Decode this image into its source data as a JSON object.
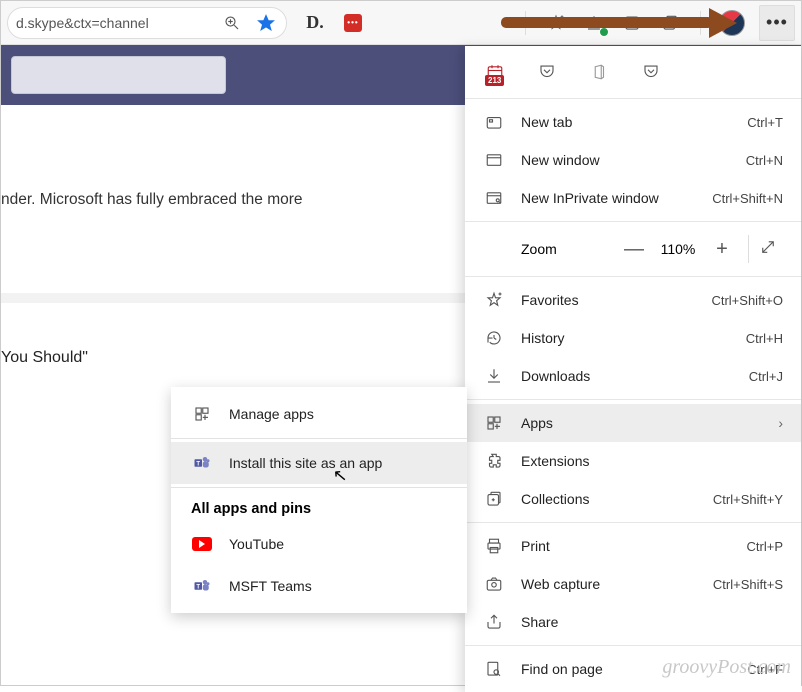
{
  "address_bar": {
    "url_text": "d.skype&ctx=channel"
  },
  "toolbar_icon_row": {
    "calendar_badge": "213"
  },
  "teams_bar": {
    "search_placeholder": ""
  },
  "content": {
    "line1": "nder. Microsoft has fully embraced the more",
    "line2": "You Should\""
  },
  "menu": {
    "new_tab": {
      "label": "New tab",
      "shortcut": "Ctrl+T"
    },
    "new_window": {
      "label": "New window",
      "shortcut": "Ctrl+N"
    },
    "new_inprivate": {
      "label": "New InPrivate window",
      "shortcut": "Ctrl+Shift+N"
    },
    "zoom": {
      "label": "Zoom",
      "value": "110%"
    },
    "favorites": {
      "label": "Favorites",
      "shortcut": "Ctrl+Shift+O"
    },
    "history": {
      "label": "History",
      "shortcut": "Ctrl+H"
    },
    "downloads": {
      "label": "Downloads",
      "shortcut": "Ctrl+J"
    },
    "apps": {
      "label": "Apps"
    },
    "extensions": {
      "label": "Extensions"
    },
    "collections": {
      "label": "Collections",
      "shortcut": "Ctrl+Shift+Y"
    },
    "print": {
      "label": "Print",
      "shortcut": "Ctrl+P"
    },
    "web_capture": {
      "label": "Web capture",
      "shortcut": "Ctrl+Shift+S"
    },
    "share": {
      "label": "Share"
    },
    "find": {
      "label": "Find on page",
      "shortcut": "Ctrl+F"
    }
  },
  "submenu": {
    "manage_apps": "Manage apps",
    "install_app": "Install this site as an app",
    "header": "All apps and pins",
    "item_youtube": "YouTube",
    "item_teams": "MSFT Teams"
  },
  "watermark": "groovyPost.com"
}
